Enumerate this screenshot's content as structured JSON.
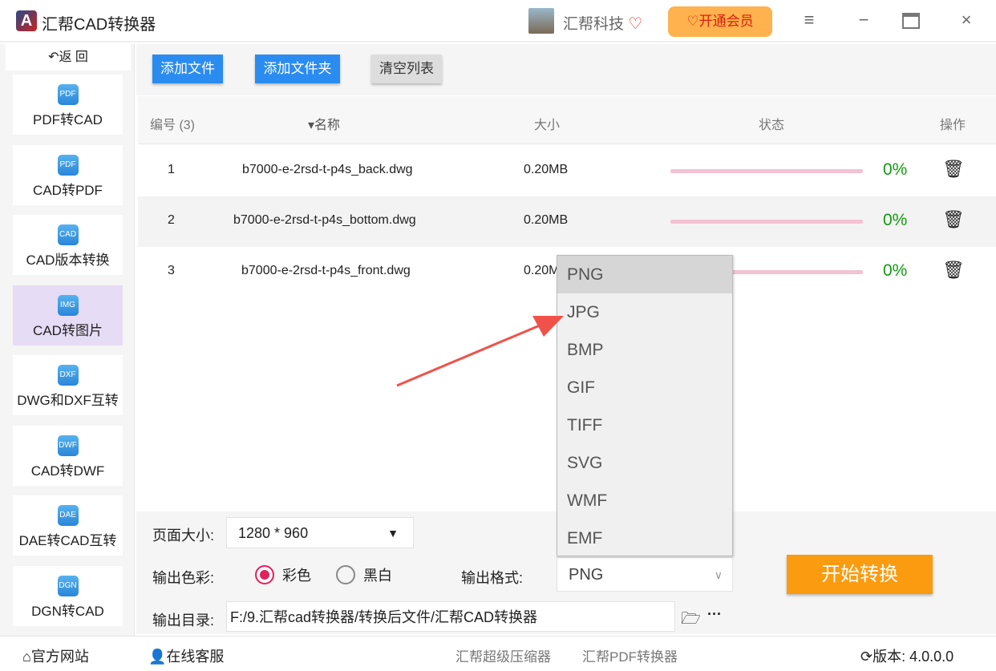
{
  "app": {
    "title": "汇帮CAD转换器",
    "logo": "A",
    "user": "汇帮科技",
    "vip": "开通会员"
  },
  "sidebar": {
    "back": "返 回",
    "items": [
      {
        "label": "PDF转CAD",
        "icon": "PDF"
      },
      {
        "label": "CAD转PDF",
        "icon": "PDF"
      },
      {
        "label": "CAD版本转换",
        "icon": "CAD"
      },
      {
        "label": "CAD转图片",
        "icon": "IMG"
      },
      {
        "label": "DWG和DXF互转",
        "icon": "DXF"
      },
      {
        "label": "CAD转DWF",
        "icon": "DWF"
      },
      {
        "label": "DAE转CAD互转",
        "icon": "DAE"
      },
      {
        "label": "DGN转CAD",
        "icon": "DGN"
      }
    ]
  },
  "toolbar": {
    "add_file": "添加文件",
    "add_folder": "添加文件夹",
    "clear": "清空列表"
  },
  "table": {
    "headers": {
      "num": "编号 (3)",
      "name": "名称",
      "size": "大小",
      "status": "状态",
      "action": "操作"
    },
    "rows": [
      {
        "num": "1",
        "name": "b7000-e-2rsd-t-p4s_back.dwg",
        "size": "0.20MB",
        "progress": "0%"
      },
      {
        "num": "2",
        "name": "b7000-e-2rsd-t-p4s_bottom.dwg",
        "size": "0.20MB",
        "progress": "0%"
      },
      {
        "num": "3",
        "name": "b7000-e-2rsd-t-p4s_front.dwg",
        "size": "0.20MB",
        "progress": "0%"
      }
    ]
  },
  "settings": {
    "page_size_label": "页面大小:",
    "page_size": "1280 * 960",
    "color_label": "输出色彩:",
    "color": "彩色",
    "bw": "黑白",
    "format_label": "输出格式:",
    "format": "PNG",
    "dir_label": "输出目录:",
    "dir": "F:/9.汇帮cad转换器/转换后文件/汇帮CAD转换器",
    "more": "···"
  },
  "format_options": [
    "PNG",
    "JPG",
    "BMP",
    "GIF",
    "TIFF",
    "SVG",
    "WMF",
    "EMF"
  ],
  "start": "开始转换",
  "footer": {
    "website": "官方网站",
    "service": "在线客服",
    "compressor": "汇帮超级压缩器",
    "pdf": "汇帮PDF转换器",
    "version": "版本:  4.0.0.0"
  },
  "colors": {
    "accent": "#2a8cf0",
    "start": "#fb9b10",
    "progress": "#f4c2d2",
    "pct": "#129a12"
  }
}
